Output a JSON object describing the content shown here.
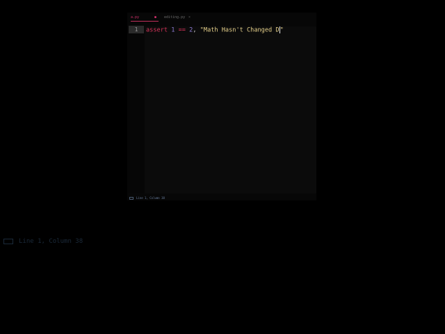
{
  "tabs": [
    {
      "label": "a.py",
      "indicator": "●",
      "active": true
    },
    {
      "label": "editing.py",
      "close": "×",
      "active": false
    }
  ],
  "editor": {
    "line_number": "1",
    "code": {
      "keyword": "assert",
      "left": "1",
      "operator": "==",
      "right": "2",
      "comma": ",",
      "string_open": "\"Math Hasn't Changed ",
      "string_tail": "D",
      "string_close": "\""
    }
  },
  "status": {
    "position": "Line 1, Column 38"
  },
  "zoomed_status": {
    "position": "Line 1, Column 38"
  },
  "colors": {
    "background": "#000000",
    "keyword": "#d7335a",
    "number": "#8f7dd6",
    "string": "#e4cf8a",
    "active_tab": "#d0306a"
  },
  "icons": [
    "panel-toggle-icon",
    "close-icon",
    "unsaved-dot-icon"
  ]
}
